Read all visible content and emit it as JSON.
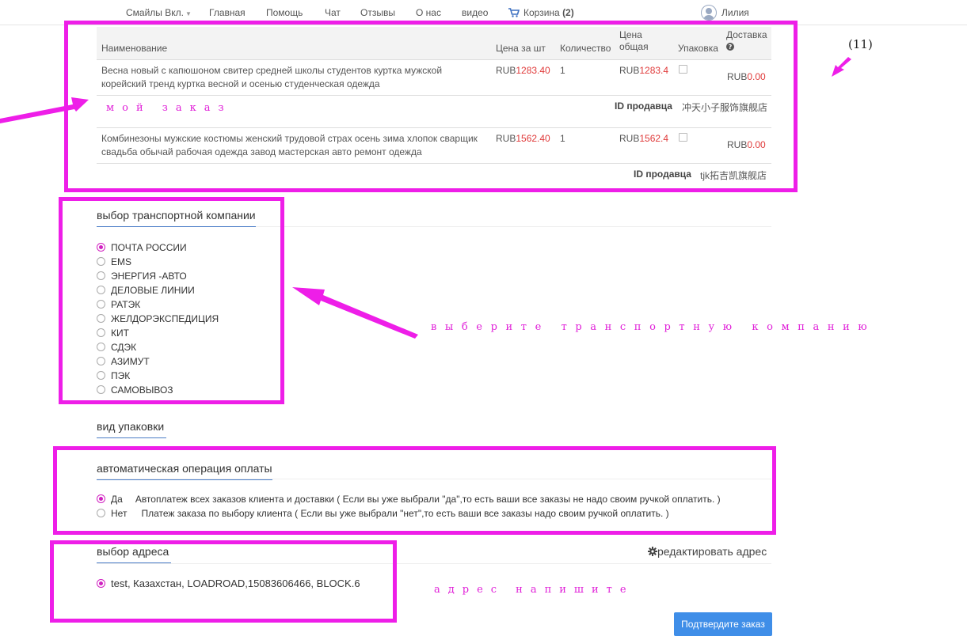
{
  "nav": {
    "smiles": "Смайлы Вкл.",
    "home": "Главная",
    "help": "Помощь",
    "chat": "Чат",
    "reviews": "Отзывы",
    "about": "О нас",
    "video": "видео",
    "cart_label": "Корзина",
    "cart_count": "(2)",
    "user_name": "Лилия"
  },
  "table": {
    "headers": {
      "name": "Наименование",
      "unit_price": "Цена за шт",
      "quantity": "Количество",
      "total_line1": "Цена",
      "total_line2": "общая",
      "packaging": "Упаковка",
      "delivery": "Доставка"
    },
    "rows": [
      {
        "name_line1": "Весна новый с капюшоном свитер средней школы студентов куртка мужской",
        "name_line2": "корейский тренд куртка весной и осенью студенческая одежда",
        "currency": "RUB",
        "unit_price": "1283.40",
        "quantity": "1",
        "total": "1283.4",
        "delivery": "0.00",
        "seller_label": "ID продавца",
        "seller": "冲天小子服饰旗舰店"
      },
      {
        "name_line1": "Комбинезоны мужские костюмы женский трудовой страх осень зима хлопок сварщик",
        "name_line2": "свадьба обычай рабочая одежда завод мастерская авто ремонт одежда",
        "currency": "RUB",
        "unit_price": "1562.40",
        "quantity": "1",
        "total": "1562.4",
        "delivery": "0.00",
        "seller_label": "ID продавца",
        "seller": "tjk拓吉凯旗舰店"
      }
    ]
  },
  "transport": {
    "title": "выбор транспортной компании",
    "options": [
      "ПОЧТА РОССИИ",
      "EMS",
      "ЭНЕРГИЯ -АВТО",
      "ДЕЛОВЫЕ ЛИНИИ",
      "РАТЭК",
      "ЖЕЛДОРЭКСПЕДИЦИЯ",
      "КИТ",
      "СДЭК",
      "АЗИМУТ",
      "ПЭК",
      "САМОВЫВОЗ"
    ],
    "selected": "ПОЧТА РОССИИ"
  },
  "packaging": {
    "title": "вид упаковки"
  },
  "payment": {
    "title": "автоматическая операция оплаты",
    "options": [
      {
        "label": "Да",
        "desc": "Автоплатеж всех заказов клиента и доставки ( Если вы уже выбрали \"да\",то есть ваши все заказы не надо своим ручкой оплатить. )"
      },
      {
        "label": "Нет",
        "desc": "Платеж заказа по выбору клиента ( Если вы уже выбрали \"нет\",то есть ваши все заказы надо своим ручкой оплатить. )"
      }
    ],
    "selected": "Да"
  },
  "address": {
    "title": "выбор адреса",
    "edit_label": "редактировать адрес",
    "value": "test, Казахстан, LOADROAD,15083606466, BLOCK.6"
  },
  "confirm_label": "Подтвердите заказ",
  "annotations": {
    "count": "(11)",
    "my_order": "мой заказ",
    "choose_transport": "выберите транспортную компанию",
    "write_address": "адрес напишите"
  },
  "colors": {
    "annotation": "#ee1ee8",
    "price_red": "#e03a3a",
    "accent_blue": "#3f8ee8",
    "underline_blue": "#4a7cc7"
  },
  "icons": [
    "cart-icon",
    "avatar",
    "gear-icon",
    "help-icon",
    "radio",
    "checkbox"
  ]
}
